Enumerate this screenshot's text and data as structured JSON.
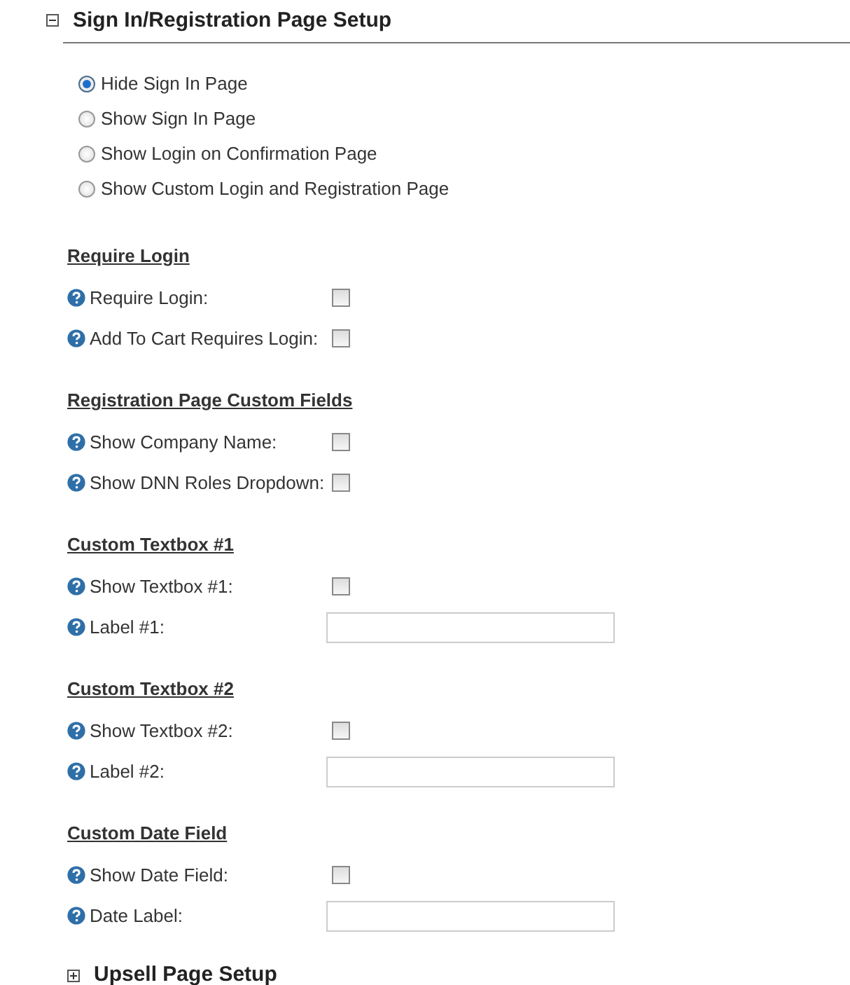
{
  "panel": {
    "title": "Sign In/Registration Page Setup",
    "expanded": true
  },
  "options": [
    {
      "label": "Hide Sign In Page",
      "selected": true
    },
    {
      "label": "Show Sign In Page",
      "selected": false
    },
    {
      "label": "Show Login on Confirmation Page",
      "selected": false
    },
    {
      "label": "Show Custom Login and Registration Page",
      "selected": false
    }
  ],
  "sections": [
    {
      "title": "Require Login",
      "rows": [
        {
          "kind": "checkbox",
          "label": "Require Login:",
          "checked": false
        },
        {
          "kind": "checkbox",
          "label": "Add To Cart Requires Login:",
          "checked": false
        }
      ]
    },
    {
      "title": "Registration Page Custom Fields",
      "rows": [
        {
          "kind": "checkbox",
          "label": "Show Company Name:",
          "checked": false
        },
        {
          "kind": "checkbox",
          "label": "Show DNN Roles Dropdown:",
          "checked": false
        }
      ]
    },
    {
      "title": "Custom Textbox #1",
      "rows": [
        {
          "kind": "checkbox",
          "label": "Show Textbox #1:",
          "checked": false
        },
        {
          "kind": "text",
          "label": "Label #1:"
        }
      ]
    },
    {
      "title": "Custom Textbox #2",
      "rows": [
        {
          "kind": "checkbox",
          "label": "Show Textbox #2:",
          "checked": false
        },
        {
          "kind": "text",
          "label": "Label #2:"
        }
      ]
    },
    {
      "title": "Custom Date Field",
      "rows": [
        {
          "kind": "checkbox",
          "label": "Show Date Field:",
          "checked": false
        },
        {
          "kind": "text",
          "label": "Date Label:"
        }
      ]
    }
  ],
  "next_panel": {
    "title": "Upsell Page Setup",
    "expanded": false
  }
}
